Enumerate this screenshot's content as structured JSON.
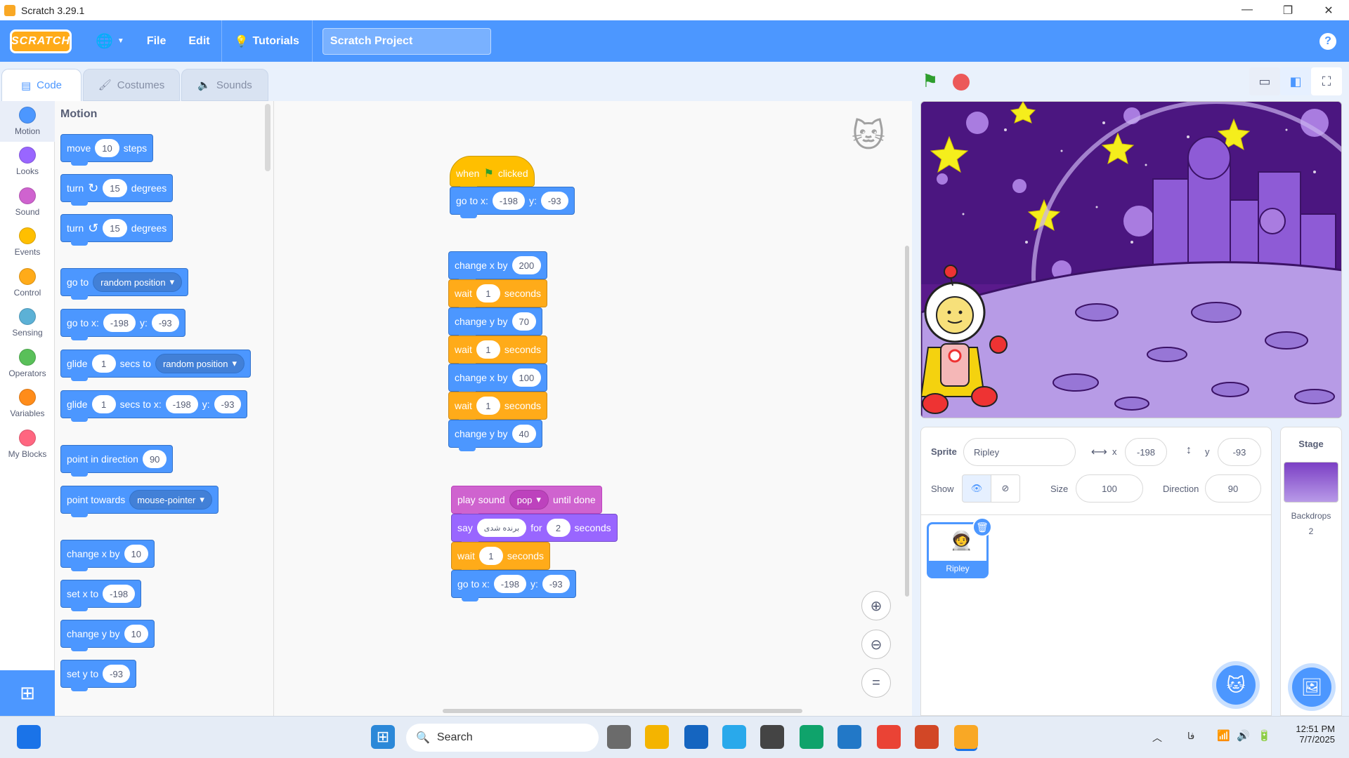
{
  "window": {
    "title": "Scratch 3.29.1"
  },
  "menubar": {
    "logo": "SCRATCH",
    "file": "File",
    "edit": "Edit",
    "tutorials": "Tutorials",
    "project_title": "Scratch Project"
  },
  "tabs": {
    "code": "Code",
    "costumes": "Costumes",
    "sounds": "Sounds"
  },
  "categories": [
    {
      "label": "Motion",
      "color": "#4c97ff"
    },
    {
      "label": "Looks",
      "color": "#9966ff"
    },
    {
      "label": "Sound",
      "color": "#cf63cf"
    },
    {
      "label": "Events",
      "color": "#ffbf00"
    },
    {
      "label": "Control",
      "color": "#ffab19"
    },
    {
      "label": "Sensing",
      "color": "#5cb1d6"
    },
    {
      "label": "Operators",
      "color": "#59c059"
    },
    {
      "label": "Variables",
      "color": "#ff8c1a"
    },
    {
      "label": "My Blocks",
      "color": "#ff6680"
    }
  ],
  "palette": {
    "title": "Motion",
    "move": {
      "a": "move",
      "v": "10",
      "b": "steps"
    },
    "turn_cw": {
      "a": "turn",
      "v": "15",
      "b": "degrees"
    },
    "turn_ccw": {
      "a": "turn",
      "v": "15",
      "b": "degrees"
    },
    "goto": {
      "a": "go to",
      "opt": "random position"
    },
    "gotoxy": {
      "a": "go to x:",
      "x": "-198",
      "b": "y:",
      "y": "-93"
    },
    "glide": {
      "a": "glide",
      "v": "1",
      "b": "secs to",
      "opt": "random position"
    },
    "glidexy": {
      "a": "glide",
      "v": "1",
      "b": "secs to x:",
      "x": "-198",
      "c": "y:",
      "y": "-93"
    },
    "pointdir": {
      "a": "point in direction",
      "v": "90"
    },
    "pointtow": {
      "a": "point towards",
      "opt": "mouse-pointer"
    },
    "changex": {
      "a": "change x by",
      "v": "10"
    },
    "setx": {
      "a": "set x to",
      "v": "-198"
    },
    "changey": {
      "a": "change y by",
      "v": "10"
    },
    "sety": {
      "a": "set y to",
      "v": "-93"
    }
  },
  "script1": {
    "hat": {
      "a": "when",
      "b": "clicked"
    },
    "goto": {
      "a": "go to x:",
      "x": "-198",
      "b": "y:",
      "y": "-93"
    }
  },
  "script2": {
    "b1": {
      "a": "change x by",
      "v": "200"
    },
    "b2": {
      "a": "wait",
      "v": "1",
      "b": "seconds"
    },
    "b3": {
      "a": "change y by",
      "v": "70"
    },
    "b4": {
      "a": "wait",
      "v": "1",
      "b": "seconds"
    },
    "b5": {
      "a": "change x by",
      "v": "100"
    },
    "b6": {
      "a": "wait",
      "v": "1",
      "b": "seconds"
    },
    "b7": {
      "a": "change y by",
      "v": "40"
    }
  },
  "script3": {
    "b1": {
      "a": "play sound",
      "opt": "pop",
      "b": "until done"
    },
    "b2": {
      "a": "say",
      "msg": "برنده شدی",
      "b": "for",
      "v": "2",
      "c": "seconds"
    },
    "b3": {
      "a": "wait",
      "v": "1",
      "b": "seconds"
    },
    "b4": {
      "a": "go to x:",
      "x": "-198",
      "b": "y:",
      "y": "-93"
    }
  },
  "sprite": {
    "label": "Sprite",
    "name": "Ripley",
    "x_label": "x",
    "x": "-198",
    "y_label": "y",
    "y": "-93",
    "show_label": "Show",
    "size_label": "Size",
    "size": "100",
    "direction_label": "Direction",
    "direction": "90",
    "thumb_name": "Ripley"
  },
  "stage": {
    "label": "Stage",
    "backdrops_label": "Backdrops",
    "backdrops_count": "2"
  },
  "taskbar": {
    "search": "Search",
    "time": "12:51 PM",
    "date": "7/7/2025",
    "lang": "فا"
  }
}
